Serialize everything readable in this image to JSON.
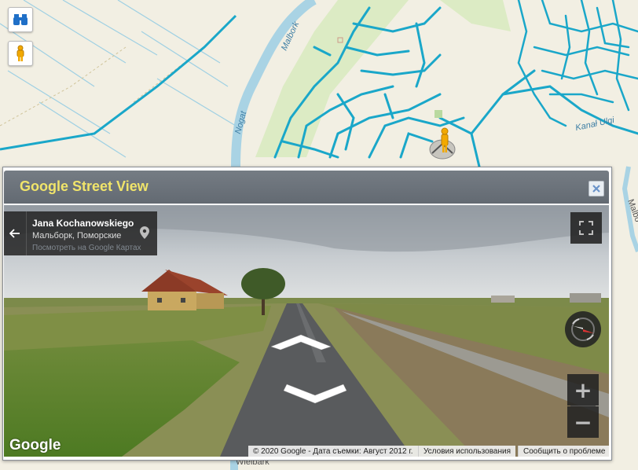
{
  "map": {
    "labels": {
      "river_malbork": "Malbork",
      "river_nogat": "Nogat",
      "canal": "Kanał Ulgi",
      "town_wielbark": "Wielbark",
      "malbo_edge": "Malbo"
    },
    "icons": {
      "binoculars": "binoculars-icon",
      "pegman": "pegman-icon"
    },
    "colors": {
      "road": "#1aa7c9",
      "river": "#a9d3e4",
      "land": "#f2efe3",
      "green": "#d8ecbc"
    }
  },
  "panel": {
    "title": "Google Street View",
    "close_icon": "close-icon"
  },
  "streetview": {
    "address": {
      "title": "Jana Kochanowskiego",
      "subtitle": "Мальборк, Поморские",
      "link": "Посмотреть на Google Картах"
    },
    "logo": "Google",
    "footer": {
      "copyright": "© 2020 Google - Дата съемки: Август 2012 г.",
      "terms": "Условия использования",
      "report": "Сообщить о проблеме"
    },
    "zoom": {
      "in": "+",
      "out": "−"
    }
  }
}
